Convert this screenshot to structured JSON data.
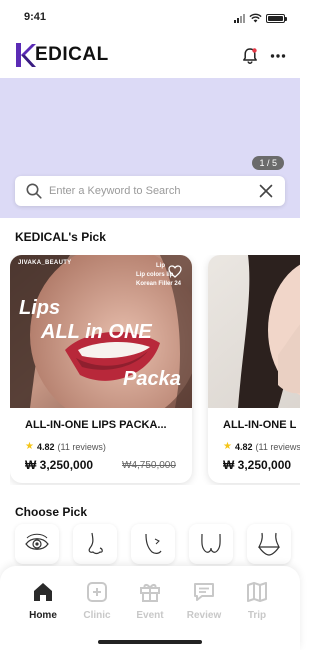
{
  "status_bar": {
    "time": "9:41"
  },
  "header": {
    "logo_text": "EDICAL",
    "logo_letter": "K"
  },
  "banner": {
    "counter": "1 / 5"
  },
  "search": {
    "placeholder": "Enter a Keyword to Search"
  },
  "sections": {
    "pick_title": "KEDICAL's Pick",
    "choose_title": "Choose Pick"
  },
  "cards": [
    {
      "title": "ALL-IN-ONE LIPS PACKA...",
      "rating": "4.82",
      "reviews": "(11 reviews)",
      "price": "₩ 3,250,000",
      "original_price": "₩4,750,000",
      "image_text": {
        "brand": "JIVAKA_BEAUTY",
        "line1": "Lips",
        "line2": "ALL in ONE",
        "line3": "Packa",
        "tag1": "Lip",
        "tag2": "Lip colors lip",
        "tag3": "Korean Filler 24"
      }
    },
    {
      "title": "ALL-IN-ONE L",
      "rating": "4.82",
      "reviews": "(11 reviews)",
      "price": "₩ 3,250,000"
    }
  ],
  "choose_pick": [
    "eye-icon",
    "nose-icon",
    "jaw-icon",
    "breast-icon",
    "body-icon"
  ],
  "bottom_nav": [
    {
      "label": "Home",
      "icon": "home-icon",
      "active": true
    },
    {
      "label": "Clinic",
      "icon": "clinic-icon",
      "active": false
    },
    {
      "label": "Event",
      "icon": "gift-icon",
      "active": false
    },
    {
      "label": "Review",
      "icon": "review-icon",
      "active": false
    },
    {
      "label": "Trip",
      "icon": "map-icon",
      "active": false
    }
  ],
  "colors": {
    "brand": "#5b2bb5",
    "banner_bg": "#dcdaf6",
    "star": "#f5c518",
    "inactive_nav": "#c8c8c8"
  }
}
